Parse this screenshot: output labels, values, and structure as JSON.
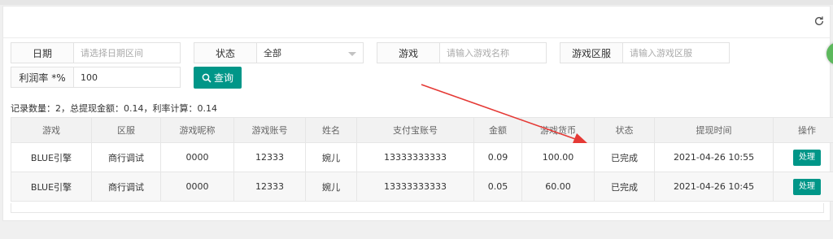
{
  "filters": {
    "date": {
      "label": "日期",
      "placeholder": "请选择日期区间",
      "value": ""
    },
    "status": {
      "label": "状态",
      "value": "全部"
    },
    "game": {
      "label": "游戏",
      "placeholder": "请输入游戏名称",
      "value": ""
    },
    "server": {
      "label": "游戏区服",
      "placeholder": "请输入游戏区服",
      "value": ""
    },
    "profit_rate": {
      "label": "利润率 *%",
      "value": "100"
    },
    "search_label": "查询"
  },
  "summary": "记录数量：2，总提现金额：0.14，利率计算：0.14",
  "table": {
    "columns": [
      "游戏",
      "区服",
      "游戏昵称",
      "游戏账号",
      "姓名",
      "支付宝账号",
      "金额",
      "游戏货币",
      "状态",
      "提现时间",
      "操作"
    ],
    "rows": [
      [
        "BLUE引擎",
        "商行调试",
        "0000",
        "12333",
        "婉儿",
        "13333333333",
        "0.09",
        "100.00",
        "已完成",
        "2021-04-26 10:55",
        "处理"
      ],
      [
        "BLUE引擎",
        "商行调试",
        "0000",
        "12333",
        "婉儿",
        "13333333333",
        "0.05",
        "60.00",
        "已完成",
        "2021-04-26 10:45",
        "处理"
      ]
    ]
  },
  "colors": {
    "accent": "#009688",
    "annotation_arrow": "#e53935"
  },
  "icons": {
    "refresh": "refresh-icon",
    "search": "search-icon"
  }
}
